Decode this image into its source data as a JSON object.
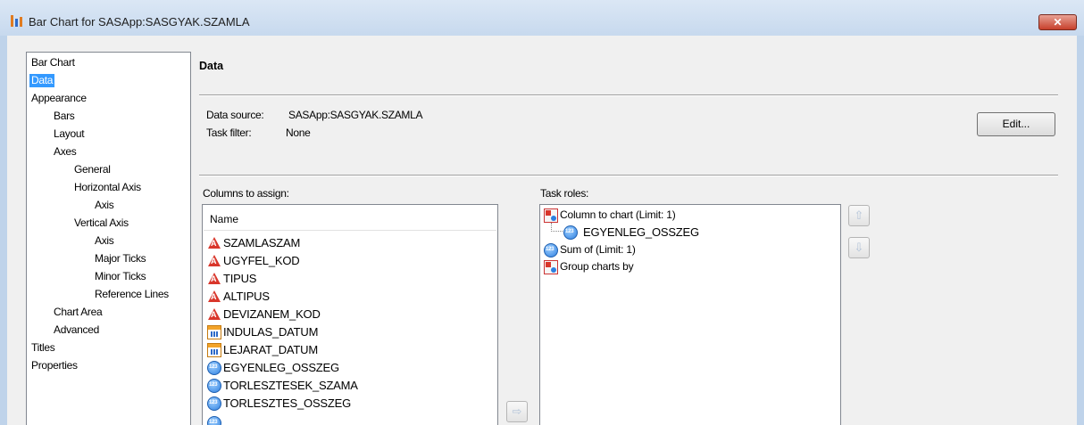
{
  "window": {
    "title": "Bar Chart for SASApp:SASGYAK.SZAMLA",
    "close_glyph": "✕"
  },
  "nav": {
    "items": [
      {
        "label": "Bar Chart",
        "name": "nav-item-bar-chart"
      },
      {
        "label": "Data",
        "name": "nav-item-data",
        "selected": true
      },
      {
        "label": "Appearance",
        "name": "nav-item-appearance"
      },
      {
        "label": "Bars",
        "name": "nav-item-bars"
      },
      {
        "label": "Layout",
        "name": "nav-item-layout"
      },
      {
        "label": "Axes",
        "name": "nav-item-axes"
      },
      {
        "label": "General",
        "name": "nav-item-general"
      },
      {
        "label": "Horizontal Axis",
        "name": "nav-item-horizontal-axis"
      },
      {
        "label": "Axis",
        "name": "nav-item-horizontal-axis-axis"
      },
      {
        "label": "Vertical Axis",
        "name": "nav-item-vertical-axis"
      },
      {
        "label": "Axis",
        "name": "nav-item-vertical-axis-axis"
      },
      {
        "label": "Major Ticks",
        "name": "nav-item-major-ticks"
      },
      {
        "label": "Minor Ticks",
        "name": "nav-item-minor-ticks"
      },
      {
        "label": "Reference Lines",
        "name": "nav-item-reference-lines"
      },
      {
        "label": "Chart Area",
        "name": "nav-item-chart-area"
      },
      {
        "label": "Advanced",
        "name": "nav-item-advanced"
      },
      {
        "label": "Titles",
        "name": "nav-item-titles"
      },
      {
        "label": "Properties",
        "name": "nav-item-properties"
      }
    ]
  },
  "data_panel": {
    "title": "Data",
    "data_source_label": "Data source:",
    "data_source_value": "SASApp:SASGYAK.SZAMLA",
    "task_filter_label": "Task filter:",
    "task_filter_value": "None",
    "edit_button": "Edit..."
  },
  "columns": {
    "label": "Columns to assign:",
    "header": "Name",
    "items": [
      {
        "name": "SZAMLASZAM",
        "type": "character",
        "icon": "character-column-icon"
      },
      {
        "name": "UGYFEL_KOD",
        "type": "character",
        "icon": "character-column-icon"
      },
      {
        "name": "TIPUS",
        "type": "character",
        "icon": "character-column-icon"
      },
      {
        "name": "ALTIPUS",
        "type": "character",
        "icon": "character-column-icon"
      },
      {
        "name": "DEVIZANEM_KOD",
        "type": "character",
        "icon": "character-column-icon"
      },
      {
        "name": "INDULAS_DATUM",
        "type": "date",
        "icon": "date-column-icon"
      },
      {
        "name": "LEJARAT_DATUM",
        "type": "date",
        "icon": "date-column-icon"
      },
      {
        "name": "EGYENLEG_OSSZEG",
        "type": "numeric",
        "icon": "numeric-column-icon"
      },
      {
        "name": "TORLESZTESEK_SZAMA",
        "type": "numeric",
        "icon": "numeric-column-icon"
      },
      {
        "name": "TORLESZTES_OSSZEG",
        "type": "numeric",
        "icon": "numeric-column-icon"
      }
    ]
  },
  "task_roles": {
    "label": "Task roles:",
    "items": [
      {
        "label": "Column to chart  (Limit: 1)",
        "icon": "role-icon"
      },
      {
        "label": "EGYENLEG_OSSZEG",
        "icon": "numeric-column-icon",
        "child": true
      },
      {
        "label": "Sum of  (Limit: 1)",
        "icon": "numeric-role-icon"
      },
      {
        "label": "Group charts by",
        "icon": "role-icon"
      }
    ]
  },
  "buttons": {
    "move_up": "⇧",
    "move_down": "⇩",
    "assign": "⇨"
  },
  "colors": {
    "selection": "#3399ff",
    "close_button": "#c7402b",
    "titlebar": "#c7d9ee"
  }
}
